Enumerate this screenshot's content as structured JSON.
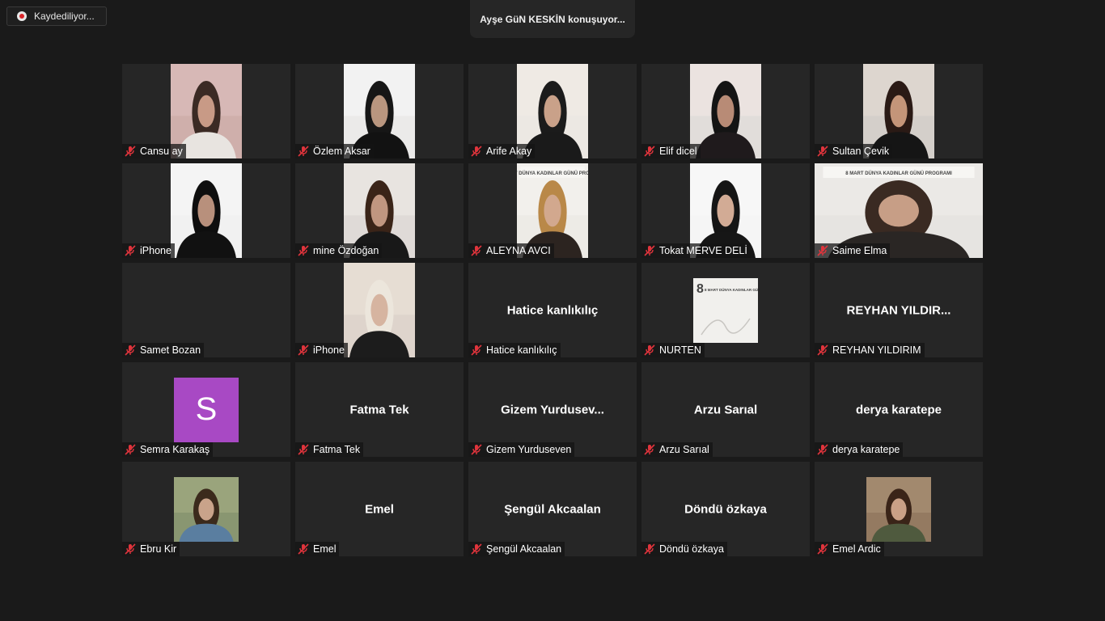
{
  "recording": {
    "label": "Kaydediliyor..."
  },
  "active_speaker": {
    "text": "Ayşe GüN KESKİN konuşuyor..."
  },
  "poster": {
    "line1": "8 MART DÜNYA KADINLAR GÜNÜ PROGRAMI"
  },
  "participants": [
    {
      "name": "Cansu ay",
      "type": "video",
      "bg": "#c9a9a3",
      "skin": "#c89a86",
      "hair": "#3b2a24",
      "cloth": "#e8e4e0",
      "wall": "#d7b8b6"
    },
    {
      "name": "Özlem Aksar",
      "type": "video",
      "bg": "#e6e4e2",
      "skin": "#b9967f",
      "hair": "#161616",
      "cloth": "#121212",
      "wall": "#f2f2f2"
    },
    {
      "name": "Arife Akay",
      "type": "video",
      "bg": "#e9e6e2",
      "skin": "#c9a189",
      "hair": "#1b1b1b",
      "cloth": "#1a1a1a",
      "wall": "#efeae4"
    },
    {
      "name": "Elif dicel",
      "type": "video",
      "bg": "#dbd8d6",
      "skin": "#b88b76",
      "hair": "#141414",
      "cloth": "#1f1a1c",
      "wall": "#ebe3e0"
    },
    {
      "name": "Sultan  Çevik",
      "type": "video",
      "bg": "#cfcac6",
      "skin": "#c49579",
      "hair": "#2a1a15",
      "cloth": "#151515",
      "wall": "#ddd6cf"
    },
    {
      "name": "iPhone",
      "type": "video",
      "bg": "#eeeeee",
      "skin": "#b8907c",
      "hair": "#0e0e0e",
      "cloth": "#111111",
      "wall": "#f4f4f4"
    },
    {
      "name": "mine Özdoğan",
      "type": "video",
      "bg": "#d8d4d1",
      "skin": "#c09680",
      "hair": "#3a2418",
      "cloth": "#181818",
      "wall": "#e8e4e0"
    },
    {
      "name": "ALEYNA AVCI",
      "type": "video",
      "bg": "#eae7e3",
      "skin": "#d2a88e",
      "hair": "#b98848",
      "cloth": "#2c2420",
      "wall": "#f2f0ec",
      "poster": true
    },
    {
      "name": "Tokat MERVE DELİ",
      "type": "video",
      "bg": "#f3f3f3",
      "skin": "#d2ab95",
      "hair": "#151515",
      "cloth": "#161616",
      "wall": "#f7f7f7"
    },
    {
      "name": "Saime Elma",
      "type": "video-wide",
      "bg": "#e3e1de",
      "skin": "#c79e86",
      "hair": "#3a2a22",
      "cloth": "#2a2624",
      "wall": "#ebe9e6",
      "poster": true
    },
    {
      "name": "Samet Bozan",
      "type": "blank"
    },
    {
      "name": "iPhone",
      "type": "video",
      "bg": "#d9cfc8",
      "skin": "#d6b4a0",
      "hair": "#ece6dc",
      "cloth": "#1c1c1c",
      "wall": "#e6ddd3"
    },
    {
      "name": "Hatice kanlıkılıç",
      "type": "text",
      "display": "Hatice kanlıkılıç"
    },
    {
      "name": "NURTEN",
      "type": "poster-thumb"
    },
    {
      "name": "REYHAN YILDIRIM",
      "type": "text",
      "display": "REYHAN YILDIR..."
    },
    {
      "name": "Semra Karakaş",
      "type": "letter",
      "letter": "S",
      "color": "#a849c4"
    },
    {
      "name": "Fatma Tek",
      "type": "text",
      "display": "Fatma Tek"
    },
    {
      "name": "Gizem Yurduseven",
      "type": "text",
      "display": "Gizem  Yurdusev..."
    },
    {
      "name": "Arzu Sarıal",
      "type": "text",
      "display": "Arzu Sarıal"
    },
    {
      "name": "derya karatepe",
      "type": "text",
      "display": "derya karatepe"
    },
    {
      "name": "Ebru Kir",
      "type": "photo",
      "bg": "#7f8e6a",
      "skin": "#c9a38a",
      "hair": "#3b2a1c",
      "cloth": "#5a7ea0",
      "wall": "#9aa47c"
    },
    {
      "name": "Emel",
      "type": "text",
      "display": "Emel"
    },
    {
      "name": "Şengül Akcaalan",
      "type": "text",
      "display": "Şengül Akcaalan"
    },
    {
      "name": "Döndü özkaya",
      "type": "text",
      "display": "Döndü özkaya"
    },
    {
      "name": "Emel Ardic",
      "type": "photo",
      "bg": "#8a7058",
      "skin": "#caa086",
      "hair": "#3a2418",
      "cloth": "#4f5a3e",
      "wall": "#a2896e"
    }
  ],
  "colors": {
    "background": "#1a1a1a",
    "tile": "#262626",
    "mute_icon": "#e0343c"
  }
}
